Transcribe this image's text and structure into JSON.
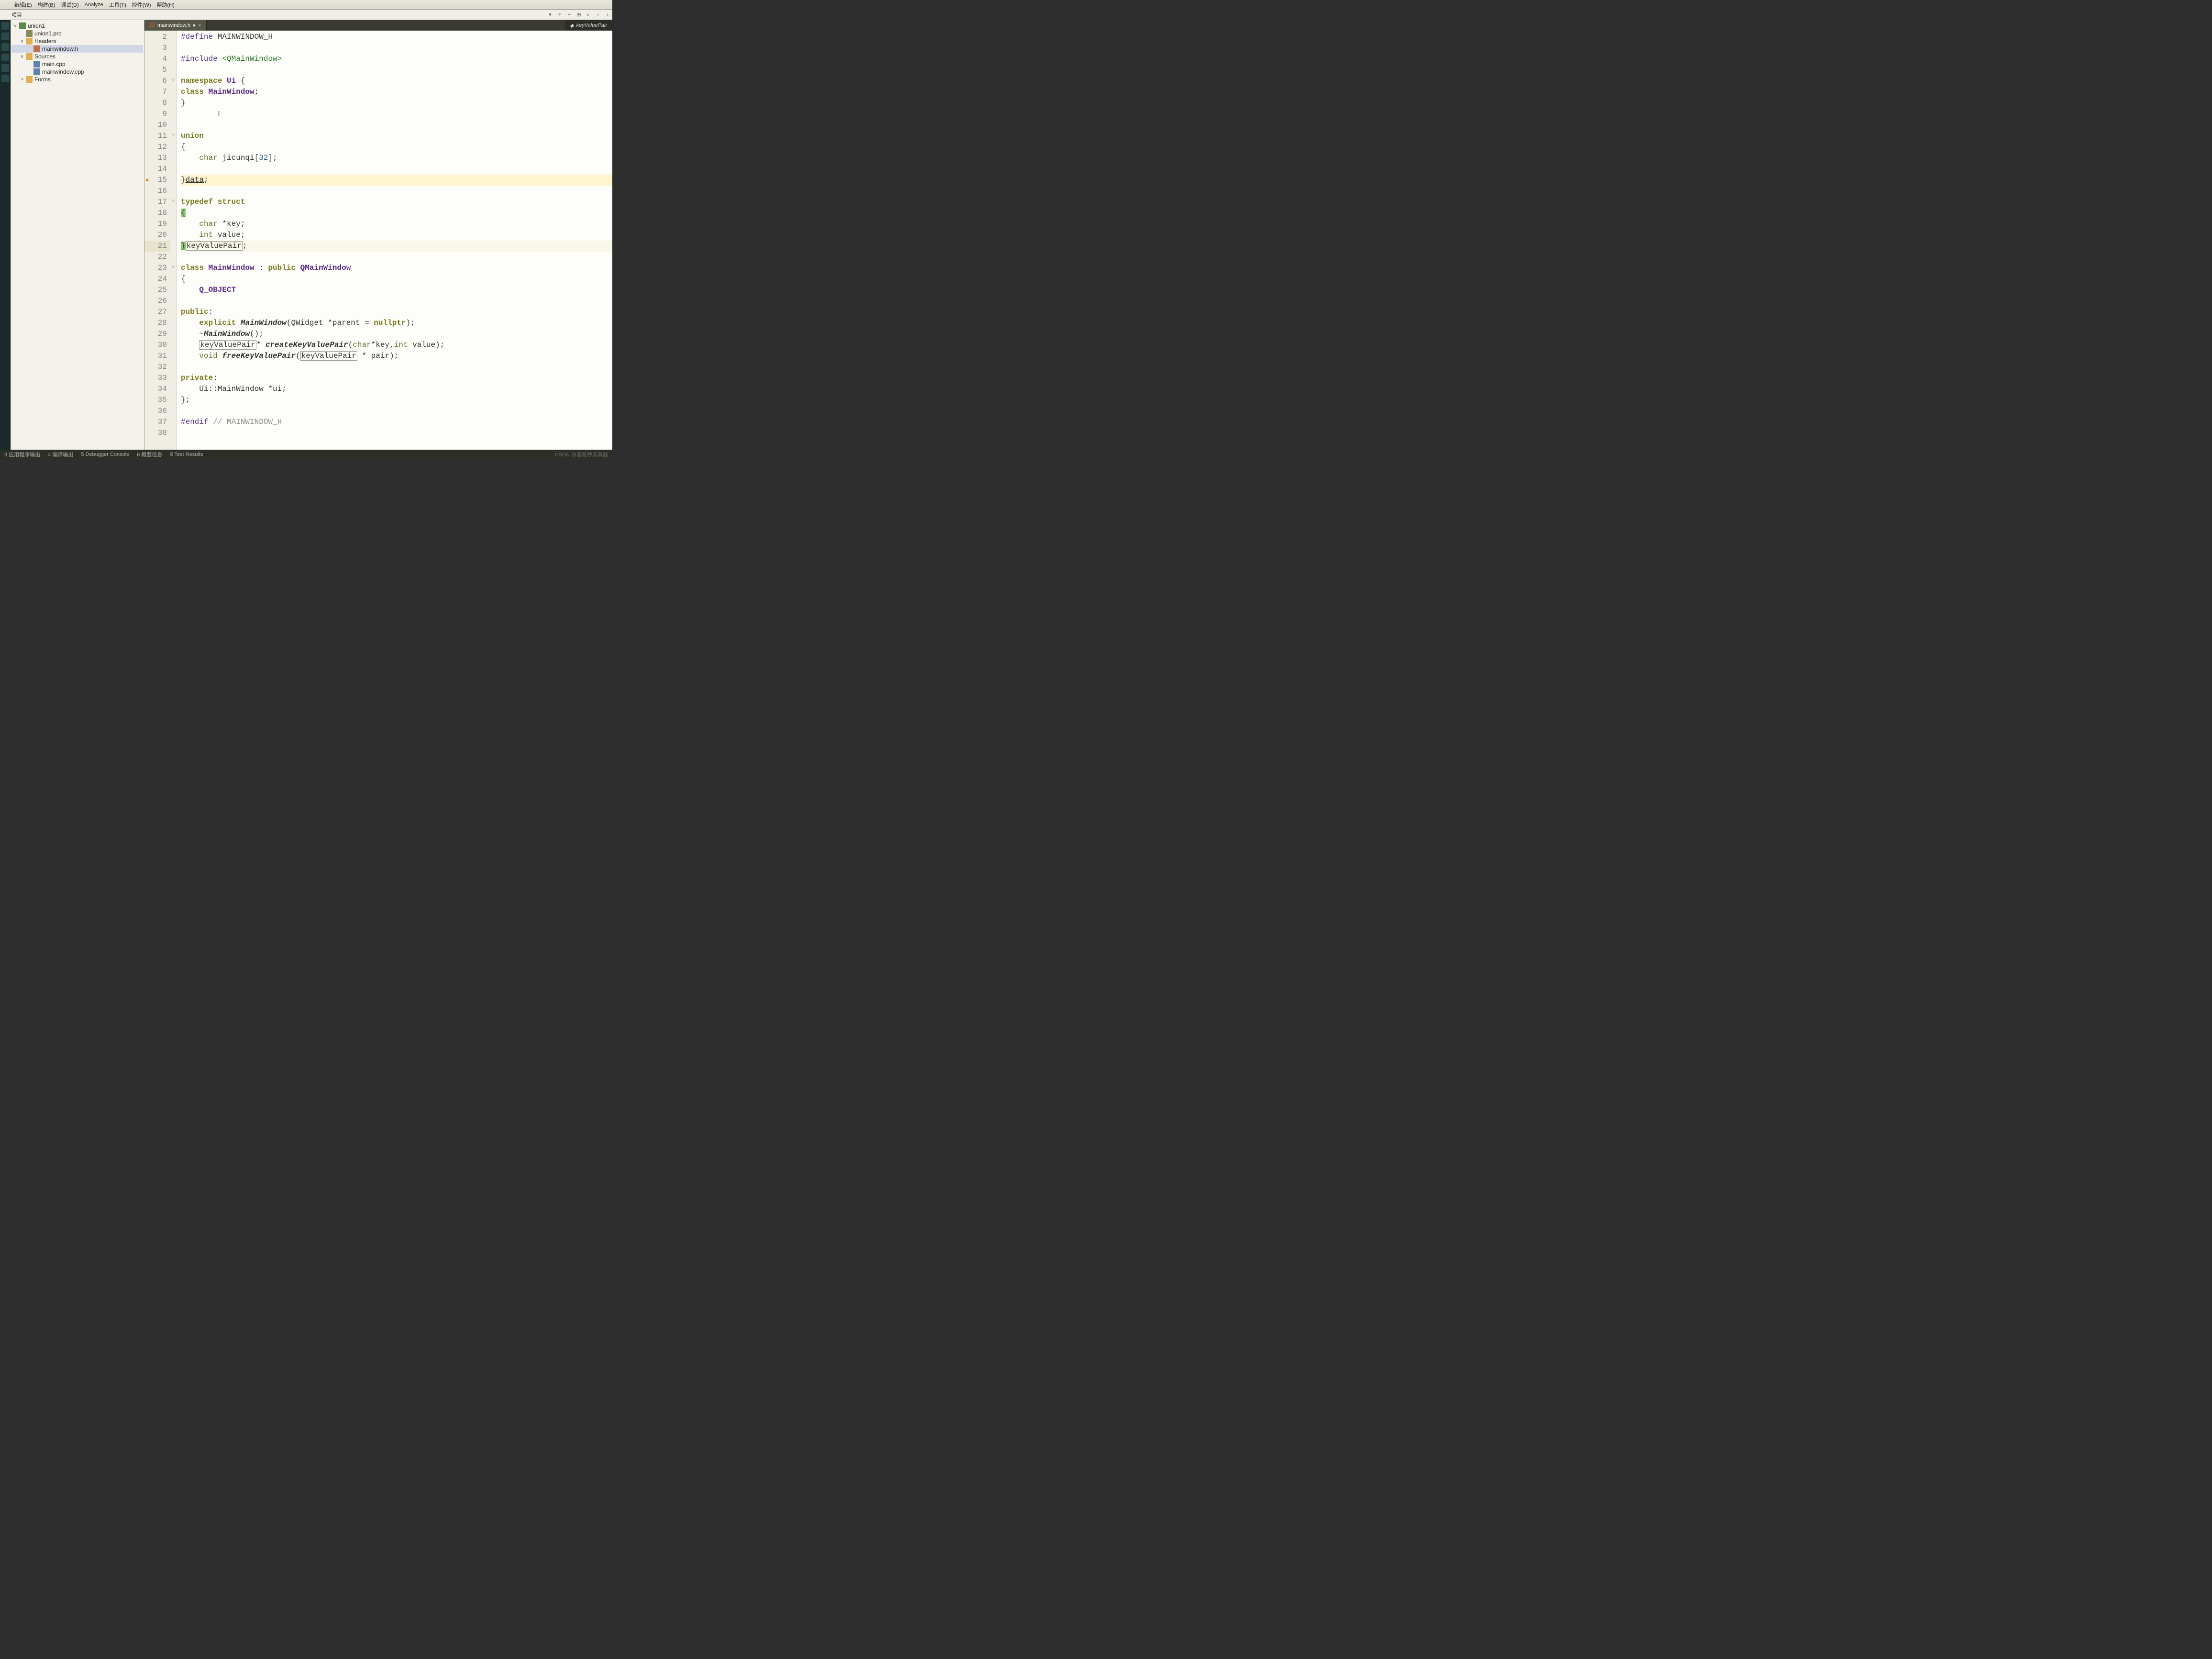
{
  "menu": {
    "items": [
      "编辑(E)",
      "构建(B)",
      "调试(D)",
      "Analyze",
      "工具(T)",
      "控件(W)",
      "帮助(H)"
    ]
  },
  "toolbar": {
    "label": "项目"
  },
  "tree": {
    "items": [
      {
        "depth": 0,
        "tw": "v",
        "icon": "proj",
        "label": "union1",
        "sel": false
      },
      {
        "depth": 1,
        "tw": "",
        "icon": "pro",
        "label": "union1.pro",
        "sel": false
      },
      {
        "depth": 1,
        "tw": "v",
        "icon": "folder",
        "label": "Headers",
        "sel": false
      },
      {
        "depth": 2,
        "tw": "",
        "icon": "hdr",
        "label": "mainwindow.h",
        "sel": true
      },
      {
        "depth": 1,
        "tw": "v",
        "icon": "folder",
        "label": "Sources",
        "sel": false
      },
      {
        "depth": 2,
        "tw": "",
        "icon": "cpp",
        "label": "main.cpp",
        "sel": false
      },
      {
        "depth": 2,
        "tw": "",
        "icon": "cpp",
        "label": "mainwindow.cpp",
        "sel": false
      },
      {
        "depth": 1,
        "tw": ">",
        "icon": "folder",
        "label": "Forms",
        "sel": false
      }
    ]
  },
  "tabs": {
    "active": {
      "label": "mainwindow.h"
    },
    "symbol": {
      "label": "keyValuePair"
    }
  },
  "code": {
    "first_line": 2,
    "current_line": 21,
    "warn_line": 15,
    "fold_lines": [
      6,
      11,
      17,
      23
    ],
    "lines": [
      {
        "n": 2,
        "t": "#define MAINWINDOW_H",
        "cls": "pp"
      },
      {
        "n": 3,
        "t": ""
      },
      {
        "n": 4,
        "t": "#include <QMainWindow>",
        "cls": "pp"
      },
      {
        "n": 5,
        "t": ""
      },
      {
        "n": 6,
        "t": "namespace Ui {"
      },
      {
        "n": 7,
        "t": "class MainWindow;"
      },
      {
        "n": 8,
        "t": "}"
      },
      {
        "n": 9,
        "t": ""
      },
      {
        "n": 10,
        "t": ""
      },
      {
        "n": 11,
        "t": "union"
      },
      {
        "n": 12,
        "t": "{"
      },
      {
        "n": 13,
        "t": "    char jicunqi[32];"
      },
      {
        "n": 14,
        "t": ""
      },
      {
        "n": 15,
        "t": "}data;"
      },
      {
        "n": 16,
        "t": ""
      },
      {
        "n": 17,
        "t": "typedef struct"
      },
      {
        "n": 18,
        "t": "{"
      },
      {
        "n": 19,
        "t": "    char *key;"
      },
      {
        "n": 20,
        "t": "    int value;"
      },
      {
        "n": 21,
        "t": "}keyValuePair;"
      },
      {
        "n": 22,
        "t": ""
      },
      {
        "n": 23,
        "t": "class MainWindow : public QMainWindow"
      },
      {
        "n": 24,
        "t": "{"
      },
      {
        "n": 25,
        "t": "    Q_OBJECT"
      },
      {
        "n": 26,
        "t": ""
      },
      {
        "n": 27,
        "t": "public:"
      },
      {
        "n": 28,
        "t": "    explicit MainWindow(QWidget *parent = nullptr);"
      },
      {
        "n": 29,
        "t": "    ~MainWindow();"
      },
      {
        "n": 30,
        "t": "    keyValuePair* createKeyValuePair(char*key,int value);"
      },
      {
        "n": 31,
        "t": "    void freeKeyValuePair(keyValuePair * pair);"
      },
      {
        "n": 32,
        "t": ""
      },
      {
        "n": 33,
        "t": "private:"
      },
      {
        "n": 34,
        "t": "    Ui::MainWindow *ui;"
      },
      {
        "n": 35,
        "t": "};"
      },
      {
        "n": 36,
        "t": ""
      },
      {
        "n": 37,
        "t": "#endif // MAINWINDOW_H"
      },
      {
        "n": 38,
        "t": ""
      }
    ]
  },
  "status": {
    "items": [
      "3 应用程序输出",
      "4 编译输出",
      "5 Debugger Console",
      "6 概要信息",
      "8 Test Results"
    ]
  },
  "watermark": "CSDN @液氮秒冻其器"
}
